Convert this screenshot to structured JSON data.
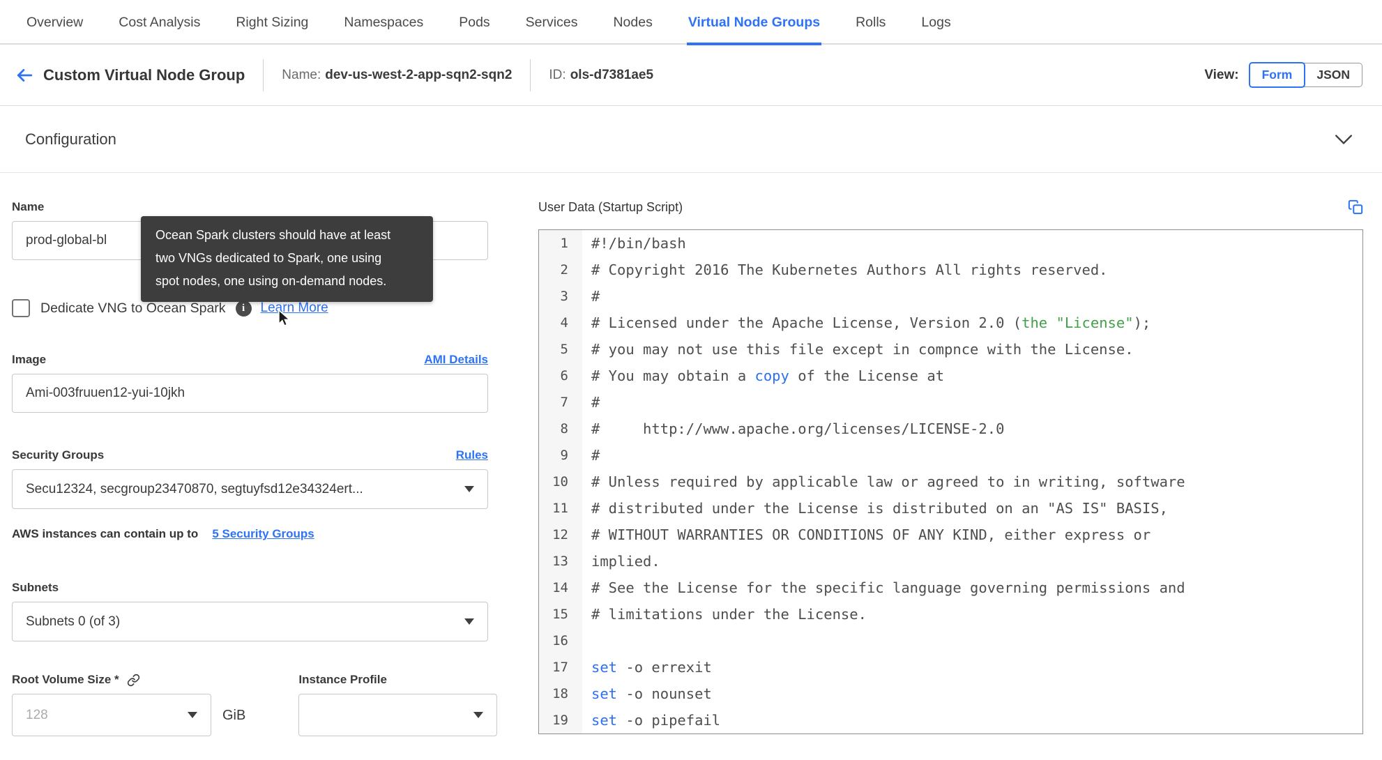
{
  "colors": {
    "accent": "#2e73f5",
    "code_green": "#43a047",
    "code_blue": "#2d6ff2",
    "tooltip_bg": "#3d3d3d"
  },
  "tabs": {
    "items": [
      {
        "label": "Overview",
        "active": false
      },
      {
        "label": "Cost Analysis",
        "active": false
      },
      {
        "label": "Right Sizing",
        "active": false
      },
      {
        "label": "Namespaces",
        "active": false
      },
      {
        "label": "Pods",
        "active": false
      },
      {
        "label": "Services",
        "active": false
      },
      {
        "label": "Nodes",
        "active": false
      },
      {
        "label": "Virtual Node Groups",
        "active": true
      },
      {
        "label": "Rolls",
        "active": false
      },
      {
        "label": "Logs",
        "active": false
      }
    ]
  },
  "header": {
    "title": "Custom Virtual Node Group",
    "name_label": "Name:",
    "name_value": "dev-us-west-2-app-sqn2-sqn2",
    "id_label": "ID:",
    "id_value": "ols-d7381ae5",
    "view_label": "View:",
    "view_options": [
      {
        "label": "Form",
        "active": true
      },
      {
        "label": "JSON",
        "active": false
      }
    ]
  },
  "section": {
    "title": "Configuration"
  },
  "form": {
    "name": {
      "label": "Name",
      "value": "prod-global-bl"
    },
    "tooltip": {
      "text": "Ocean Spark clusters should have at least\ntwo VNGs dedicated to Spark, one using\nspot nodes, one using on-demand nodes."
    },
    "dedicate": {
      "label": "Dedicate VNG to Ocean Spark",
      "checked": false,
      "info_glyph": "i",
      "learn_more": "Learn More"
    },
    "image": {
      "label": "Image",
      "link": "AMI Details",
      "value": "Ami-003fruuen12-yui-10jkh"
    },
    "security_groups": {
      "label": "Security Groups",
      "link": "Rules",
      "value": "Secu12324, secgroup23470870, segtuyfsd12e34324ert...",
      "caption": "AWS instances can contain up to",
      "caption_link": "5 Security Groups"
    },
    "subnets": {
      "label": "Subnets",
      "value": "Subnets 0 (of 3)"
    },
    "root_volume": {
      "label": "Root Volume Size *",
      "placeholder": "128",
      "unit": "GiB"
    },
    "instance_profile": {
      "label": "Instance Profile",
      "value": ""
    }
  },
  "editor": {
    "label": "User Data (Startup Script)",
    "lines": [
      {
        "num": 1,
        "segments": [
          {
            "t": "#!/bin/bash",
            "c": "d"
          }
        ]
      },
      {
        "num": 2,
        "segments": [
          {
            "t": "# Copyright 2016 The Kubernetes Authors All rights reserved.",
            "c": "d"
          }
        ]
      },
      {
        "num": 3,
        "segments": [
          {
            "t": "#",
            "c": "d"
          }
        ]
      },
      {
        "num": 4,
        "segments": [
          {
            "t": "# Licensed under the Apache License, Version 2.0 (",
            "c": "d"
          },
          {
            "t": "the \"License\"",
            "c": "g"
          },
          {
            "t": ");",
            "c": "d"
          }
        ]
      },
      {
        "num": 5,
        "segments": [
          {
            "t": "# you may not use this file except in compnce with the License.",
            "c": "d"
          }
        ]
      },
      {
        "num": 6,
        "segments": [
          {
            "t": "# You may obtain a ",
            "c": "d"
          },
          {
            "t": "copy",
            "c": "b"
          },
          {
            "t": " of the License at",
            "c": "d"
          }
        ]
      },
      {
        "num": 7,
        "segments": [
          {
            "t": "#",
            "c": "d"
          }
        ]
      },
      {
        "num": 8,
        "segments": [
          {
            "t": "#     http://www.apache.org/licenses/LICENSE-2.0",
            "c": "d"
          }
        ]
      },
      {
        "num": 9,
        "segments": [
          {
            "t": "#",
            "c": "d"
          }
        ]
      },
      {
        "num": 10,
        "segments": [
          {
            "t": "# Unless required by applicable law or agreed to in writing, software",
            "c": "d"
          }
        ]
      },
      {
        "num": 11,
        "segments": [
          {
            "t": "# distributed under the License is distributed on an \"AS IS\" BASIS,",
            "c": "d"
          }
        ]
      },
      {
        "num": 12,
        "segments": [
          {
            "t": "# WITHOUT WARRANTIES OR CONDITIONS OF ANY KIND, either express or",
            "c": "d"
          }
        ]
      },
      {
        "num": 13,
        "segments": [
          {
            "t": "implied.",
            "c": "d"
          }
        ]
      },
      {
        "num": 14,
        "segments": [
          {
            "t": "# See the License for the specific language governing permissions and",
            "c": "d"
          }
        ]
      },
      {
        "num": 15,
        "segments": [
          {
            "t": "# limitations under the License.",
            "c": "d"
          }
        ]
      },
      {
        "num": 16,
        "segments": [
          {
            "t": "",
            "c": "d"
          }
        ]
      },
      {
        "num": 17,
        "segments": [
          {
            "t": "set",
            "c": "b"
          },
          {
            "t": " -o errexit",
            "c": "d"
          }
        ]
      },
      {
        "num": 18,
        "segments": [
          {
            "t": "set",
            "c": "b"
          },
          {
            "t": " -o nounset",
            "c": "d"
          }
        ]
      },
      {
        "num": 19,
        "segments": [
          {
            "t": "set",
            "c": "b"
          },
          {
            "t": " -o pipefail",
            "c": "d"
          }
        ]
      }
    ]
  }
}
